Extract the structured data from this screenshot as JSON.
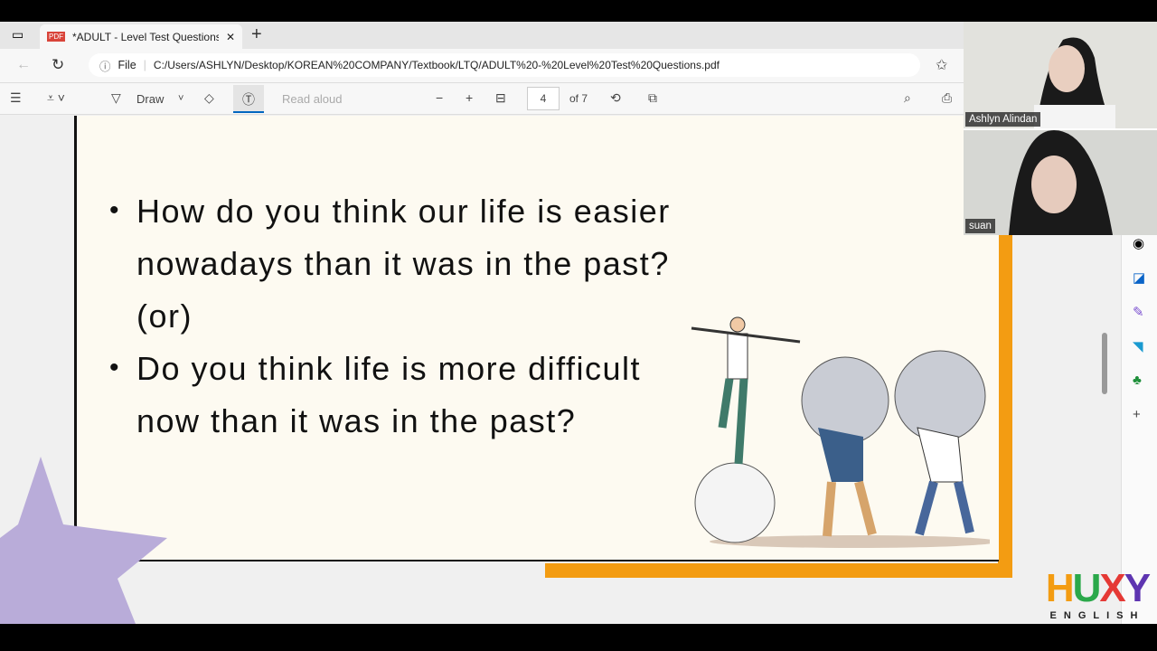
{
  "browser": {
    "tab_title": "*ADULT - Level Test Questions.pdf",
    "new_tab": "+",
    "file_label": "File",
    "url": "C:/Users/ASHLYN/Desktop/KOREAN%20COMPANY/Textbook/LTQ/ADULT%20-%20Level%20Test%20Questions.pdf"
  },
  "pdf_toolbar": {
    "draw_label": "Draw",
    "read_aloud": "Read aloud",
    "page_number": "4",
    "page_total": "of 7"
  },
  "slide": {
    "bullet1_line1": "How do you think our life is easier",
    "bullet1_line2": "nowadays than it was in the past?",
    "or": "(or)",
    "bullet2_line1": "Do you think life is more difficult",
    "bullet2_line2": "now than it was in the past?"
  },
  "video": {
    "participant1": "Ashlyn Alindan",
    "participant2": "suan"
  },
  "logo": {
    "text": "HUXY",
    "sub": "ENGLISH"
  },
  "colors": {
    "orange": "#f39c12",
    "slide_bg": "#fdfaf1"
  }
}
